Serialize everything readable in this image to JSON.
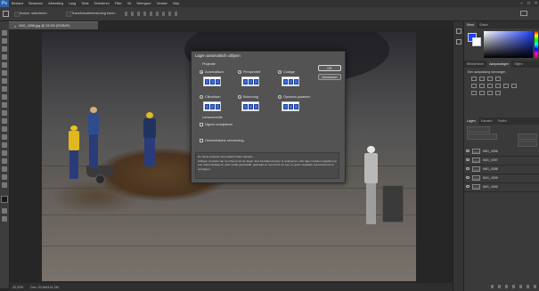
{
  "app": {
    "logo": "Ps",
    "window_controls": [
      "–",
      "□",
      "×"
    ]
  },
  "menu": [
    "Bestand",
    "Bewerken",
    "Afbeelding",
    "Laag",
    "Tekst",
    "Selecteren",
    "Filter",
    "3D",
    "Weergave",
    "Venster",
    "Help"
  ],
  "options_bar": {
    "auto_select_label": "Autom. selecteren",
    "show_transform_label": "Transformatiebesturing tonen"
  },
  "document": {
    "tab_title": "IMG_4396.jpg @ 33,3% (RGB/8*)"
  },
  "statusbar": {
    "zoom": "33,33%",
    "doc_info": "Doc: 20,6M/141,2M"
  },
  "panels": {
    "color_tabs": [
      "Kleur",
      "Stalen"
    ],
    "adjust_tabs": [
      "Bibliotheken",
      "Aanpassingen",
      "Stijlen"
    ],
    "adjust_hint": "Een aanpassing toevoegen",
    "layers_tabs": [
      "Lagen",
      "Kanalen",
      "Paden"
    ],
    "layers": [
      "IMG_4396",
      "IMG_4397",
      "IMG_4398",
      "IMG_4399",
      "IMG_4400"
    ]
  },
  "dialog": {
    "title": "Lagen automatisch uitlijnen",
    "projection_heading": "Projectie",
    "projections": [
      "Automatisch",
      "Perspectief",
      "Collage",
      "Cilindrisch",
      "Bolvormig",
      "Opnieuw plaatsen"
    ],
    "selected_projection": "Automatisch",
    "lens_heading": "Lenscorrectie",
    "vignette_label": "Vignet verwijderen",
    "distortion_label": "Geometrische vervorming",
    "ok_label": "OK",
    "cancel_label": "Annuleren",
    "description_1": "De beste projectie automatisch laten bepalen.",
    "description_2": "Uitlijnen op basis van de inhoud van de lagen door beeldkenmerken te analyseren. Alle lagen worden uitgelijnd op een referentielaag en waar nodig geschaald, gedraaid en vervormd om een zo goed mogelijke overeenkomst te verkrijgen."
  },
  "colors": {
    "accent": "#1e40ff",
    "bg": "#282828",
    "dialog_bg": "#535353"
  }
}
